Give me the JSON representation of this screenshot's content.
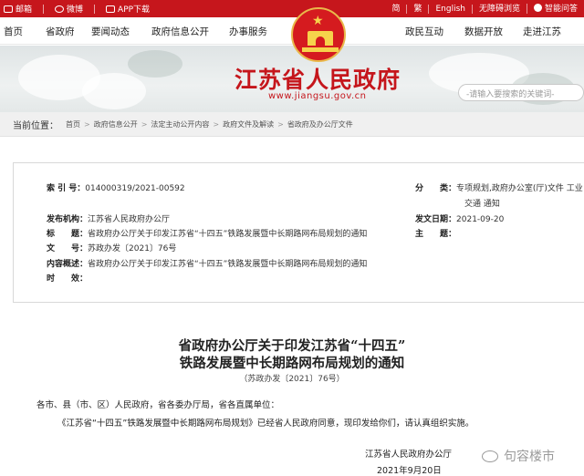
{
  "topbar": {
    "left": [
      {
        "icon": "mail-icon",
        "label": "邮箱"
      },
      {
        "icon": "weibo-icon",
        "label": "微博"
      },
      {
        "icon": "app-icon",
        "label": "APP下载"
      }
    ],
    "right": [
      {
        "label": "简"
      },
      {
        "label": "繁"
      },
      {
        "label": "English"
      },
      {
        "label": "无障碍浏览"
      },
      {
        "icon": "assistant-icon",
        "label": "智能问答"
      }
    ]
  },
  "nav": {
    "left": [
      "首页",
      "省政府",
      "要闻动态",
      "政府信息公开",
      "办事服务"
    ],
    "right": [
      "政民互动",
      "数据开放",
      "走进江苏"
    ]
  },
  "banner": {
    "title": "江苏省人民政府",
    "url": "www.jiangsu.gov.cn"
  },
  "search": {
    "placeholder": "-请输入要搜索的关键词-"
  },
  "breadcrumb": {
    "lead": "当前位置：",
    "items": [
      "首页",
      "政府信息公开",
      "法定主动公开内容",
      "政府文件及解读",
      "省政府及办公厅文件"
    ]
  },
  "meta": {
    "index_k": "索 引 号：",
    "index_v": "014000319/2021-00592",
    "class_k": "分　　类：",
    "class_v1": "专项规划,政府办公室(厅)文件 工业",
    "class_v2": "交通 通知",
    "org_k": "发布机构：",
    "org_v": "江苏省人民政府办公厅",
    "date_k": "发文日期：",
    "date_v": "2021-09-20",
    "title_k": "标　　题：",
    "title_v": "省政府办公厅关于印发江苏省“十四五”铁路发展暨中长期路网布局规划的通知",
    "topic_k": "主　　题：",
    "topic_v": "",
    "num_k": "文　　号：",
    "num_v": "苏政办发〔2021〕76号",
    "summary_k": "内容概述：",
    "summary_v": "省政府办公厅关于印发江苏省“十四五”铁路发展暨中长期路网布局规划的通知",
    "valid_k": "时　　效："
  },
  "article": {
    "title1": "省政府办公厅关于印发江苏省“十四五”",
    "title2": "铁路发展暨中长期路网布局规划的通知",
    "doc_no": "（苏政办发〔2021〕76号）",
    "salutation": "各市、县（市、区）人民政府，省各委办厅局，省各直属单位：",
    "body": "《江苏省“十四五”铁路发展暨中长期路网布局规划》已经省人民政府同意，现印发给你们，请认真组织实施。",
    "signature": "江苏省人民政府办公厅",
    "date": "2021年9月20日"
  },
  "watermark": {
    "text": "句容楼市"
  }
}
